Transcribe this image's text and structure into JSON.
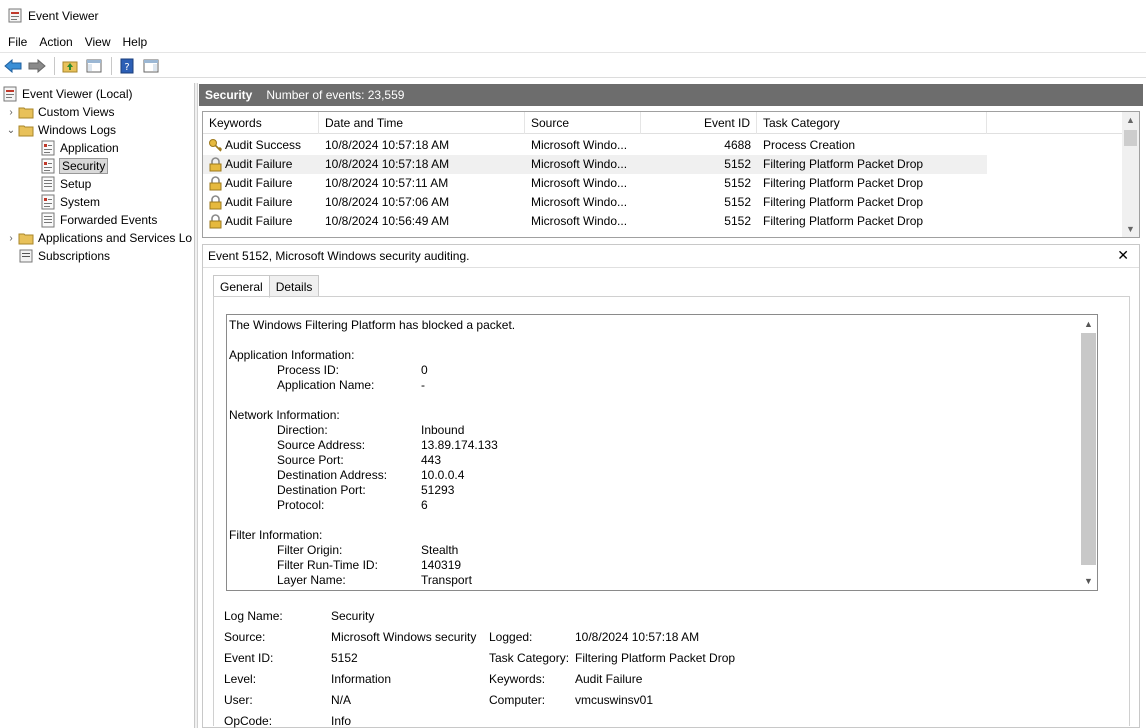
{
  "window": {
    "title": "Event Viewer"
  },
  "menu": [
    "File",
    "Action",
    "View",
    "Help"
  ],
  "tree": {
    "root": "Event Viewer (Local)",
    "custom_views": "Custom Views",
    "windows_logs": "Windows Logs",
    "logs": [
      "Application",
      "Security",
      "Setup",
      "System",
      "Forwarded Events"
    ],
    "apps_services": "Applications and Services Lo",
    "subscriptions": "Subscriptions"
  },
  "header": {
    "title": "Security",
    "count_text": "Number of events: 23,559"
  },
  "columns": [
    "Keywords",
    "Date and Time",
    "Source",
    "Event ID",
    "Task Category"
  ],
  "events": [
    {
      "keyword": "Audit Success",
      "date": "10/8/2024 10:57:18 AM",
      "source": "Microsoft Windo...",
      "id": "4688",
      "category": "Process Creation",
      "icon": "key-icon"
    },
    {
      "keyword": "Audit Failure",
      "date": "10/8/2024 10:57:18 AM",
      "source": "Microsoft Windo...",
      "id": "5152",
      "category": "Filtering Platform Packet Drop",
      "icon": "lock-icon"
    },
    {
      "keyword": "Audit Failure",
      "date": "10/8/2024 10:57:11 AM",
      "source": "Microsoft Windo...",
      "id": "5152",
      "category": "Filtering Platform Packet Drop",
      "icon": "lock-icon"
    },
    {
      "keyword": "Audit Failure",
      "date": "10/8/2024 10:57:06 AM",
      "source": "Microsoft Windo...",
      "id": "5152",
      "category": "Filtering Platform Packet Drop",
      "icon": "lock-icon"
    },
    {
      "keyword": "Audit Failure",
      "date": "10/8/2024 10:56:49 AM",
      "source": "Microsoft Windo...",
      "id": "5152",
      "category": "Filtering Platform Packet Drop",
      "icon": "lock-icon"
    }
  ],
  "detail": {
    "title": "Event 5152, Microsoft Windows security auditing.",
    "tabs": [
      "General",
      "Details"
    ],
    "message": {
      "intro": "The Windows Filtering Platform has blocked a packet.",
      "app_heading": "Application Information:",
      "app": [
        {
          "k": "Process ID:",
          "v": "0"
        },
        {
          "k": "Application Name:",
          "v": "-"
        }
      ],
      "net_heading": "Network Information:",
      "net": [
        {
          "k": "Direction:",
          "v": "Inbound"
        },
        {
          "k": "Source Address:",
          "v": "13.89.174.133"
        },
        {
          "k": "Source Port:",
          "v": "443"
        },
        {
          "k": "Destination Address:",
          "v": "10.0.0.4"
        },
        {
          "k": "Destination Port:",
          "v": "51293"
        },
        {
          "k": "Protocol:",
          "v": "6"
        }
      ],
      "filter_heading": "Filter Information:",
      "filter": [
        {
          "k": "Filter Origin:",
          "v": "Stealth"
        },
        {
          "k": "Filter Run-Time ID:",
          "v": "140319"
        },
        {
          "k": "Layer Name:",
          "v": "Transport"
        }
      ]
    },
    "props": {
      "log_name_label": "Log Name:",
      "log_name": "Security",
      "source_label": "Source:",
      "source": "Microsoft Windows security",
      "logged_label": "Logged:",
      "logged": "10/8/2024 10:57:18 AM",
      "event_id_label": "Event ID:",
      "event_id": "5152",
      "task_label": "Task Category:",
      "task": "Filtering Platform Packet Drop",
      "level_label": "Level:",
      "level": "Information",
      "keywords_label": "Keywords:",
      "keywords": "Audit Failure",
      "user_label": "User:",
      "user": "N/A",
      "computer_label": "Computer:",
      "computer": "vmcuswinsv01",
      "opcode_label": "OpCode:",
      "opcode": "Info"
    }
  }
}
